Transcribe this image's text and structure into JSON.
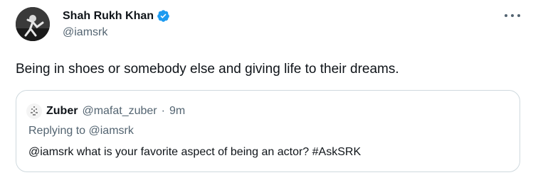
{
  "author": {
    "display_name": "Shah Rukh Khan",
    "handle": "@iamsrk",
    "verified": true,
    "verified_icon": "verified-badge-icon",
    "verified_color": "#1d9bf0"
  },
  "tweet": {
    "text": "Being in shoes or somebody else and giving life to their dreams."
  },
  "quoted_tweet": {
    "display_name": "Zuber",
    "handle": "@mafat_zuber",
    "separator": "·",
    "time": "9m",
    "replying_to": "Replying to @iamsrk",
    "text": "@iamsrk what is your favorite aspect of being an actor? #AskSRK"
  },
  "menu": {
    "icon": "more-options-icon"
  },
  "colors": {
    "primary_text": "#0f1419",
    "secondary_text": "#536471",
    "border": "#cfd9de"
  }
}
